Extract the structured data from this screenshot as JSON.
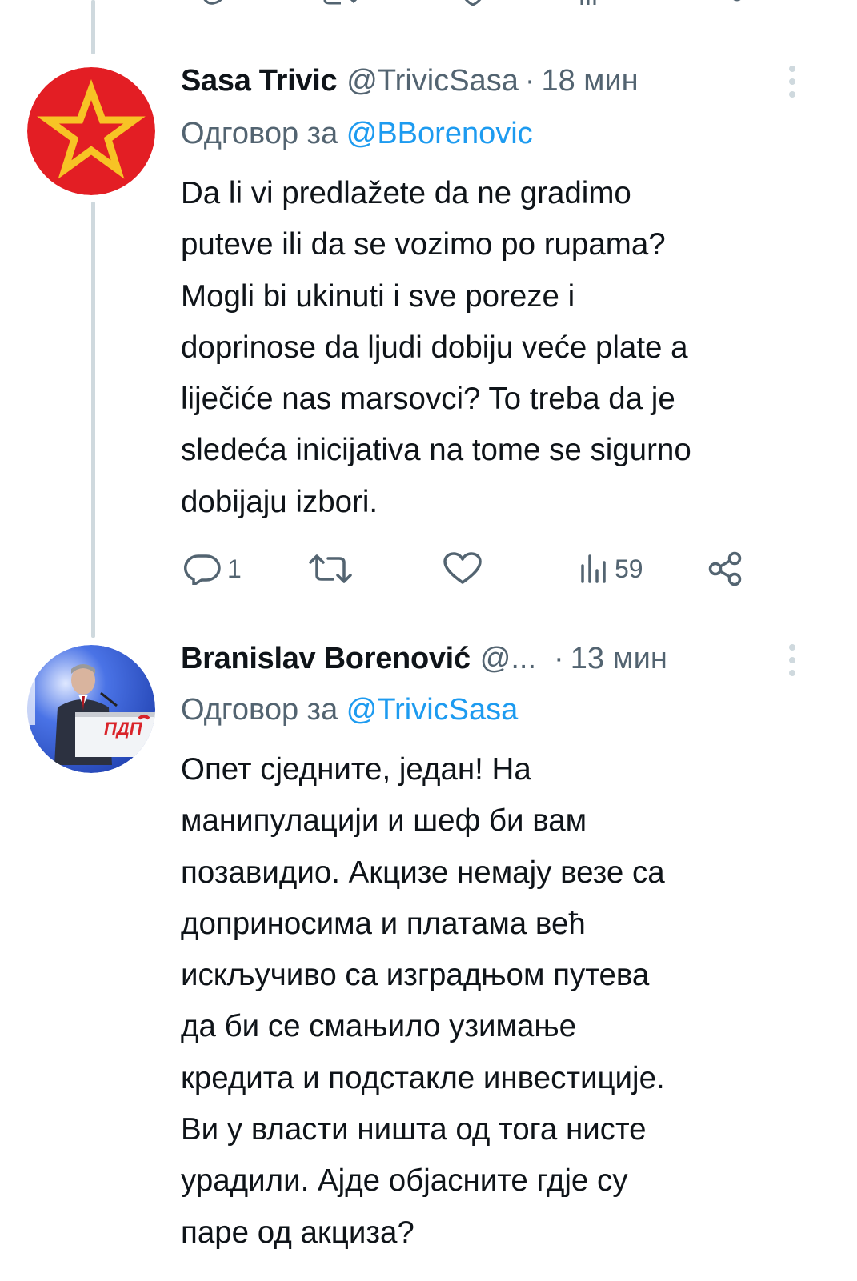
{
  "tweets": [
    {
      "display_name": "Sasa Trivic",
      "handle": "@TrivicSasa",
      "separator": "·",
      "time": "18 мин",
      "reply_prefix": "Одговор за",
      "reply_mention": "@BBorenovic",
      "text_lines": [
        "Da li vi predlažete da ne gradimo",
        "puteve ili da se vozimo po rupama?",
        "Mogli bi ukinuti i sve poreze i",
        "doprinose da ljudi dobiju veće plate a",
        "liječiće nas marsovci? To treba da je",
        "sledeća inicijativa na tome se sigurno",
        "dobijaju izbori."
      ],
      "actions": {
        "reply_count": "1",
        "retweet_count": "",
        "like_count": "",
        "views_count": "59"
      },
      "avatar_icon": "red-star-icon",
      "avatar_colors": {
        "background": "#e31e24",
        "star": "#f7c325"
      }
    },
    {
      "display_name": "Branislav Borenović",
      "handle": "@...",
      "separator": "·",
      "time": "13 мин",
      "reply_prefix": "Одговор за",
      "reply_mention": "@TrivicSasa",
      "text_lines": [
        "Опет сједните, један! На",
        "манипулацији и шеф би вам",
        "позавидио. Акцизе немају везе са",
        "доприносима и платама већ",
        "искључиво са изградњом путева",
        "да би се смањило узимање",
        "кредита и подстакле инвестиције.",
        "Ви у власти ништа од тога нисте",
        "урадили. Ајде објасните гдје су",
        "паре од акциза?"
      ],
      "avatar_icon": "speaker-photo-avatar",
      "avatar_colors": {
        "background": "#2b4fc9",
        "podium": "#f2f4f7",
        "accent": "#d9232a"
      }
    }
  ],
  "colors": {
    "primary_text": "#0f1419",
    "secondary_text": "#536471",
    "link": "#1d9bf0",
    "thread_line": "#cfd9de"
  }
}
